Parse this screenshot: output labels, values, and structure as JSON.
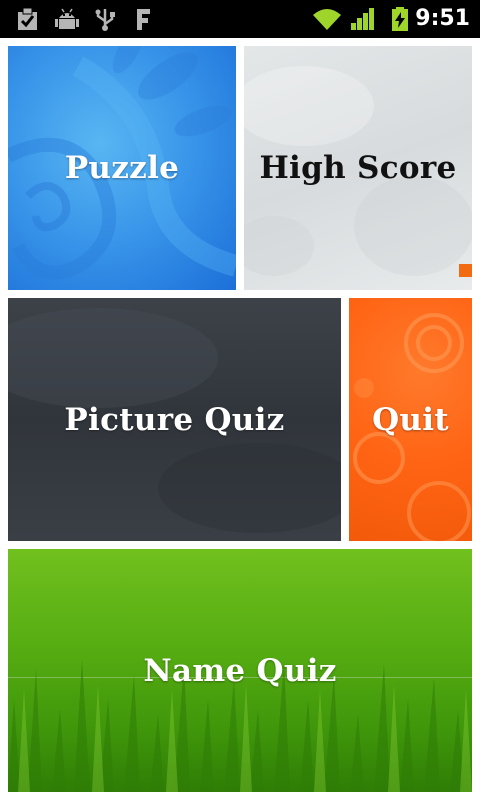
{
  "status_bar": {
    "time": "9:51",
    "left_icons": [
      "checkbox-notification-icon",
      "android-debug-icon",
      "usb-icon",
      "f-app-icon"
    ],
    "right_icons": [
      "wifi-icon",
      "signal-icon",
      "battery-charging-icon"
    ],
    "accent_green": "#9fd52a"
  },
  "menu": {
    "puzzle": {
      "label": "Puzzle",
      "color": "#3a97ea"
    },
    "high_score": {
      "label": "High Score",
      "color": "#dfe2e3"
    },
    "picture_quiz": {
      "label": "Picture Quiz",
      "color": "#353a40"
    },
    "quit": {
      "label": "Quit",
      "color": "#ff6414"
    },
    "name_quiz": {
      "label": "Name Quiz",
      "color": "#56ad12"
    }
  }
}
